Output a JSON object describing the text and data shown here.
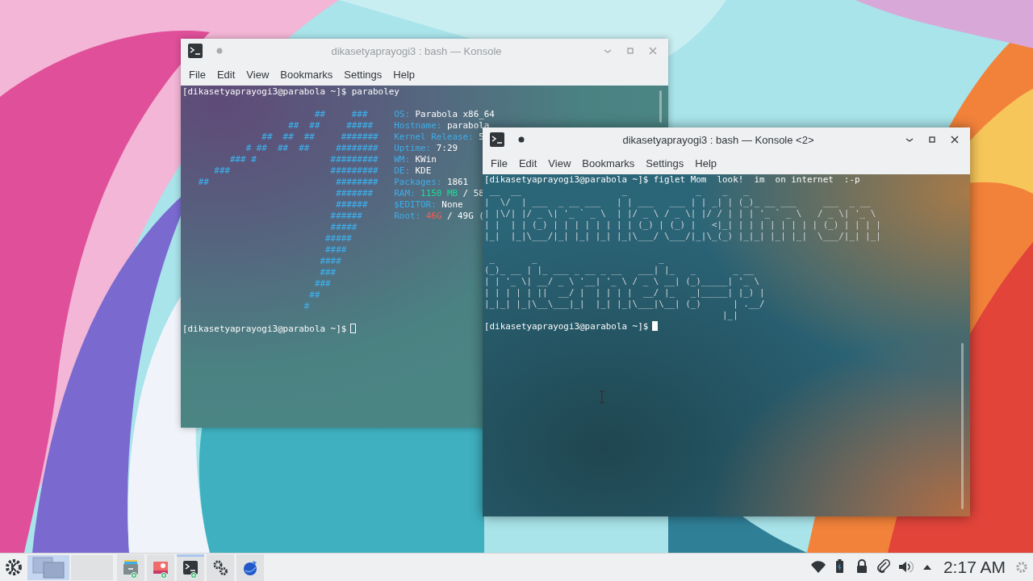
{
  "windows": [
    {
      "title": "dikasetyaprayogi3 : bash — Konsole",
      "active": false,
      "menu": [
        "File",
        "Edit",
        "View",
        "Bookmarks",
        "Settings",
        "Help"
      ],
      "lines": [
        {
          "kind": "prompt",
          "text": "[dikasetyaprayogi3@parabola ~]$ paraboley"
        },
        {
          "kind": "blank"
        },
        {
          "kind": "fetch",
          "art": "                         ##     ###",
          "info": [
            {
              "text": "OS:",
              "color": "#3daee9"
            },
            {
              "text": "Parabola x86_64",
              "color": "#fcfcfc"
            }
          ]
        },
        {
          "kind": "fetch",
          "art": "                    ##  ##     #####",
          "info": [
            {
              "text": "Hostname:",
              "color": "#3daee9"
            },
            {
              "text": "parabola",
              "color": "#fcfcfc"
            }
          ]
        },
        {
          "kind": "fetch",
          "art": "               ##  ##  ##     #######",
          "info": [
            {
              "text": "Kernel Release:",
              "color": "#3daee9"
            },
            {
              "text": "5",
              "color": "#fcfcfc"
            }
          ]
        },
        {
          "kind": "fetch",
          "art": "            # ##  ##  ##     ########",
          "info": [
            {
              "text": "Uptime:",
              "color": "#3daee9"
            },
            {
              "text": "7:29",
              "color": "#fcfcfc"
            }
          ]
        },
        {
          "kind": "fetch",
          "art": "         ### #              #########",
          "info": [
            {
              "text": "WM:",
              "color": "#3daee9"
            },
            {
              "text": "KWin",
              "color": "#fcfcfc"
            }
          ]
        },
        {
          "kind": "fetch",
          "art": "      ###                   #########",
          "info": [
            {
              "text": "DE:",
              "color": "#3daee9"
            },
            {
              "text": "KDE",
              "color": "#fcfcfc"
            }
          ]
        },
        {
          "kind": "fetch",
          "art": "   ##                        ########",
          "info": [
            {
              "text": "Packages:",
              "color": "#3daee9"
            },
            {
              "text": "1861",
              "color": "#fcfcfc"
            }
          ]
        },
        {
          "kind": "fetch",
          "art": "                             #######",
          "info": [
            {
              "text": "RAM:",
              "color": "#3daee9"
            },
            {
              "text": "1150 MB",
              "color": "#1cdc9a"
            },
            {
              "text": "/ 58",
              "color": "#fcfcfc"
            }
          ]
        },
        {
          "kind": "fetch",
          "art": "                             ######",
          "info": [
            {
              "text": "$EDITOR:",
              "color": "#3daee9"
            },
            {
              "text": "None",
              "color": "#fcfcfc"
            }
          ]
        },
        {
          "kind": "fetch",
          "art": "                            ######",
          "info": [
            {
              "text": "Root:",
              "color": "#3daee9"
            },
            {
              "text": "46G",
              "color": "#ff5a4e"
            },
            {
              "text": "/ 49G (",
              "color": "#fcfcfc"
            }
          ]
        },
        {
          "kind": "fetch",
          "art": "                            #####"
        },
        {
          "kind": "fetch",
          "art": "                           #####"
        },
        {
          "kind": "fetch",
          "art": "                           ####"
        },
        {
          "kind": "fetch",
          "art": "                          ####"
        },
        {
          "kind": "fetch",
          "art": "                          ###"
        },
        {
          "kind": "fetch",
          "art": "                         ###"
        },
        {
          "kind": "fetch",
          "art": "                        ##"
        },
        {
          "kind": "fetch",
          "art": "                       #"
        },
        {
          "kind": "blank"
        },
        {
          "kind": "prompt",
          "text": "[dikasetyaprayogi3@parabola ~]$",
          "cursor": {
            "focused": false
          }
        }
      ]
    },
    {
      "title": "dikasetyaprayogi3 : bash — Konsole <2>",
      "active": true,
      "menu": [
        "File",
        "Edit",
        "View",
        "Bookmarks",
        "Settings",
        "Help"
      ],
      "lines": [
        {
          "kind": "prompt",
          "text": "[dikasetyaprayogi3@parabola ~]$ figlet Mom  look!  im  on internet  :-p"
        },
        {
          "kind": "art",
          "text": " __  __                   _             _    _   _"
        },
        {
          "kind": "art",
          "text": "|  \\/  | ___  _ __ ___   | | ___   ___ | | _| | (_)_ __ ___     ___  _ __"
        },
        {
          "kind": "art",
          "text": "| |\\/| |/ _ \\| '_ ` _ \\  | |/ _ \\ / _ \\| |/ / | | | '_ ` _ \\   / _ \\| '_ \\"
        },
        {
          "kind": "art",
          "text": "| |  | | (_) | | | | | | | | (_) | (_) |   <|_| | | | | | | | | (_) | | | |"
        },
        {
          "kind": "art",
          "text": "|_|  |_|\\___/|_| |_| |_| |_|\\___/ \\___/|_|\\_(_) |_|_| |_| |_|  \\___/|_| |_|"
        },
        {
          "kind": "blank"
        },
        {
          "kind": "art",
          "text": " _       _                       _"
        },
        {
          "kind": "art",
          "text": "(_)_ __ | |_ ___ _ __ _ __   ___| |_   _       _ __"
        },
        {
          "kind": "art",
          "text": "| | '_ \\| __/ _ \\ '__| '_ \\ / _ \\ __| (_)_____| '_ \\"
        },
        {
          "kind": "art",
          "text": "| | | | | ||  __/ |  | | | |  __/ |_   _|_____| |_) |"
        },
        {
          "kind": "art",
          "text": "|_|_| |_|\\__\\___|_|  |_| |_|\\___|\\__| (_)      | .__/"
        },
        {
          "kind": "art",
          "text": "                                             |_|"
        },
        {
          "kind": "prompt",
          "text": "[dikasetyaprayogi3@parabola ~]$",
          "cursor": {
            "focused": true
          }
        }
      ]
    }
  ],
  "panel": {
    "pager": [
      {
        "selected": true
      },
      {
        "selected": false
      }
    ],
    "tasks": [
      {
        "kind": "files",
        "active": false
      },
      {
        "kind": "images",
        "active": false
      },
      {
        "kind": "terminal",
        "active": true
      },
      {
        "kind": "settings",
        "active": false
      },
      {
        "kind": "browser",
        "active": false
      }
    ],
    "tray": [
      {
        "kind": "wifi"
      },
      {
        "kind": "battery"
      },
      {
        "kind": "lock"
      },
      {
        "kind": "clip"
      },
      {
        "kind": "volume"
      },
      {
        "kind": "expand"
      }
    ],
    "clock": "2:17 AM"
  }
}
